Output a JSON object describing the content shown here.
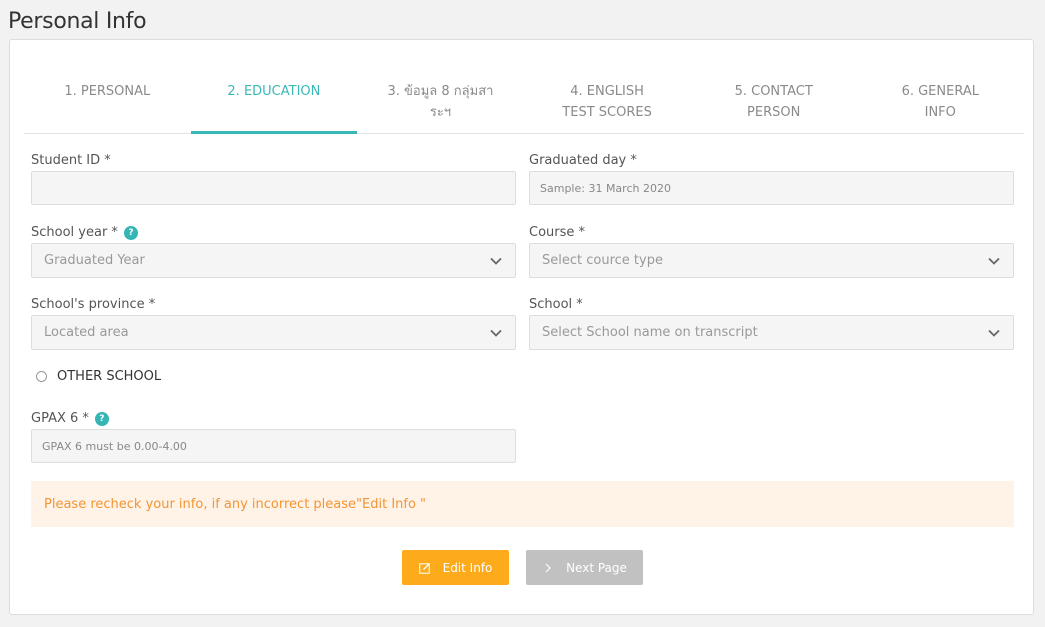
{
  "page": {
    "title": "Personal Info"
  },
  "tabs": [
    {
      "label": "1. PERSONAL"
    },
    {
      "label": "2. EDUCATION"
    },
    {
      "label": "3. ข้อมูล 8 กลุ่มสาระฯ"
    },
    {
      "label": "4. ENGLISH TEST SCORES"
    },
    {
      "label": "5. CONTACT PERSON"
    },
    {
      "label": "6. GENERAL INFO"
    }
  ],
  "active_tab": "2. EDUCATION",
  "form": {
    "student_id": {
      "label": "Student ID *",
      "value": "",
      "placeholder": ""
    },
    "graduated_day": {
      "label": "Graduated day *",
      "value": "",
      "placeholder": "Sample: 31 March 2020"
    },
    "school_year": {
      "label": "School year *",
      "selected": "Graduated Year"
    },
    "course": {
      "label": "Course *",
      "selected": "Select cource type"
    },
    "school_province": {
      "label": "School's province *",
      "selected": "Located area"
    },
    "school": {
      "label": "School *",
      "selected": "Select School name on transcript"
    },
    "other_school": {
      "label": "OTHER SCHOOL",
      "checked": false
    },
    "gpax": {
      "label": "GPAX 6 *",
      "value": "",
      "placeholder": "GPAX 6 must be 0.00-4.00"
    },
    "help_glyph": "?"
  },
  "alert": {
    "text": "Please recheck your info, if any incorrect please\"Edit Info \""
  },
  "buttons": {
    "edit_label": "Edit Info",
    "next_label": "Next Page"
  },
  "colors": {
    "accent": "#3ab7b7",
    "edit_button": "#fdab1a",
    "next_button": "#c1c1c1",
    "alert_bg": "#fff3e8",
    "alert_text": "#f29534"
  }
}
